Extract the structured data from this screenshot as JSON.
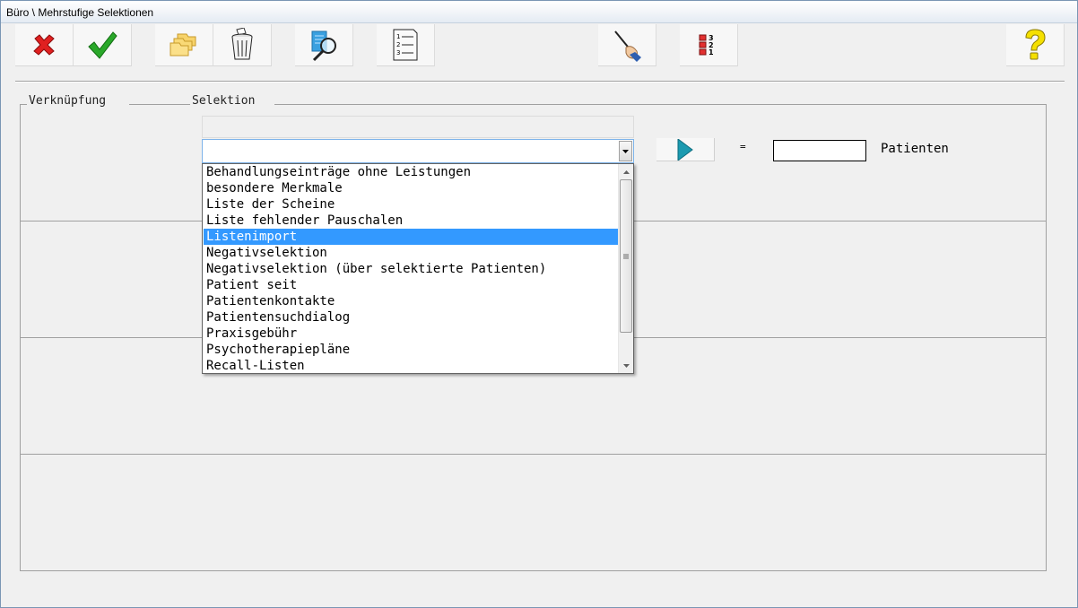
{
  "window": {
    "title": "Büro \\ Mehrstufige Selektionen"
  },
  "toolbar": {
    "buttons": [
      {
        "name": "cancel",
        "icon": "red-x-icon"
      },
      {
        "name": "confirm",
        "icon": "green-check-icon"
      },
      {
        "name": "folders",
        "icon": "folder-stack-icon"
      },
      {
        "name": "delete",
        "icon": "trash-can-icon"
      },
      {
        "name": "search",
        "icon": "magnifier-page-icon"
      },
      {
        "name": "numbered-list",
        "icon": "numbered-list-icon"
      },
      {
        "name": "edit",
        "icon": "pen-hand-icon"
      },
      {
        "name": "ranking",
        "icon": "ranking-321-icon"
      },
      {
        "name": "help",
        "icon": "question-mark-icon"
      }
    ],
    "ranking_digits": [
      "3",
      "2",
      "1"
    ],
    "list_digits": [
      "1",
      "2",
      "3"
    ]
  },
  "groups": {
    "link_label": "Verknüpfung",
    "selection_label": "Selektion"
  },
  "selection": {
    "current_value": "",
    "equals": "=",
    "count_value": "",
    "count_unit": "Patienten",
    "options": [
      "Behandlungseinträge ohne Leistungen",
      "besondere Merkmale",
      "Liste der Scheine",
      "Liste fehlender Pauschalen",
      "Listenimport",
      "Negativselektion",
      "Negativselektion (über selektierte Patienten)",
      "Patient seit",
      "Patientenkontakte",
      "Patientensuchdialog",
      "Praxisgebühr",
      "Psychotherapiepläne",
      "Recall-Listen"
    ],
    "highlighted_option": "Listenimport"
  },
  "colors": {
    "highlight": "#3399ff",
    "go_arrow": "#1b9ab0",
    "accept": "#2aa82a",
    "cancel": "#e02020",
    "help": "#f5e000"
  }
}
